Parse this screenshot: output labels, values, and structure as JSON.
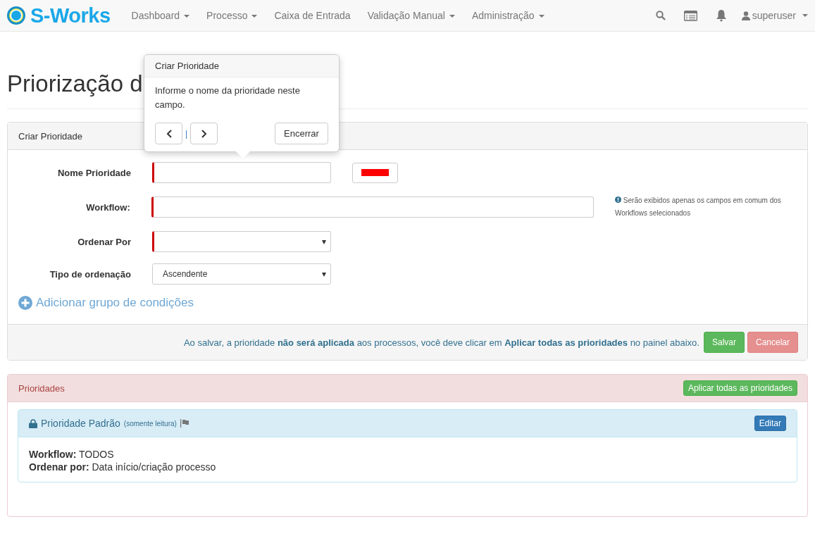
{
  "navbar": {
    "brand": "S-Works",
    "items": [
      {
        "label": "Dashboard",
        "dropdown": true
      },
      {
        "label": "Processo",
        "dropdown": true
      },
      {
        "label": "Caixa de Entrada",
        "dropdown": false
      },
      {
        "label": "Validação Manual",
        "dropdown": true
      },
      {
        "label": "Administração",
        "dropdown": true
      }
    ],
    "user": "superuser"
  },
  "page_title": "Priorização d",
  "popover": {
    "title": "Criar Prioridade",
    "body": "Informe o nome da prioridade neste campo.",
    "separator": "|",
    "close": "Encerrar"
  },
  "form_panel": {
    "heading": "Criar Prioridade",
    "fields": [
      {
        "kind": "text",
        "label": "Nome Prioridade",
        "required": true,
        "color": "#ff0000"
      },
      {
        "kind": "wide",
        "label": "Workflow:",
        "required": true,
        "help": "Serão exibidos apenas os campos em comum dos Workflows selecionados"
      },
      {
        "kind": "select",
        "label": "Ordenar Por",
        "required": true
      },
      {
        "kind": "select",
        "label": "Tipo de ordenação",
        "required": false,
        "value": "Ascendente"
      }
    ],
    "add_link": "Adicionar grupo de condições",
    "footer_note": "Ao salvar, a prioridade **não será aplicada** aos processos, você deve clicar em **Aplicar todas as prioridades** no painel abaixo.",
    "save": "Salvar",
    "cancel": "Cancelar"
  },
  "priorities_panel": {
    "heading": "Prioridades",
    "apply": "Aplicar todas as prioridades",
    "items": [
      {
        "title": "Prioridade Padrão",
        "note": "(somente leitura)",
        "edit": "Editar",
        "details": [
          {
            "label": "Workflow:",
            "value": "TODOS"
          },
          {
            "label": "Ordenar por:",
            "value": "Data início/criação processo"
          }
        ]
      }
    ]
  }
}
